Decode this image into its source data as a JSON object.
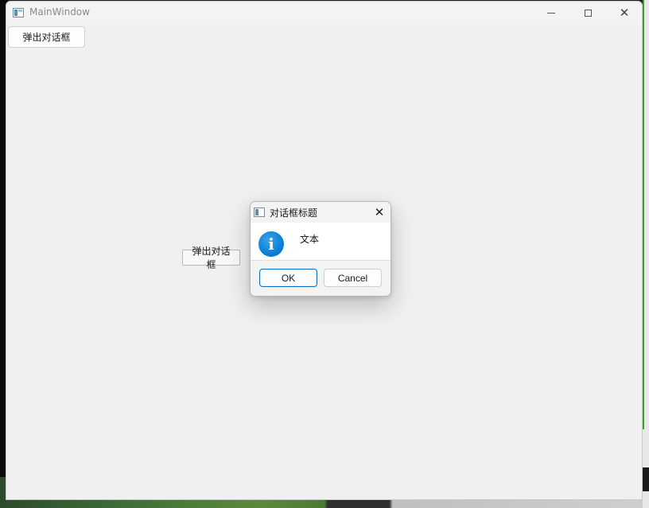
{
  "main_window": {
    "title": "MainWindow",
    "icon": "app-window-icon",
    "controls": {
      "minimize": "minimize-icon",
      "maximize": "maximize-icon",
      "close": "close-icon",
      "close_glyph": "✕"
    },
    "top_button_label": "弹出对话框",
    "center_button_label": "弹出对话框"
  },
  "dialog": {
    "title": "对话框标题",
    "icon": "info-icon",
    "icon_glyph": "i",
    "message": "文本",
    "close_glyph": "✕",
    "ok_label": "OK",
    "cancel_label": "Cancel",
    "accent_color": "#0f6cbd"
  }
}
